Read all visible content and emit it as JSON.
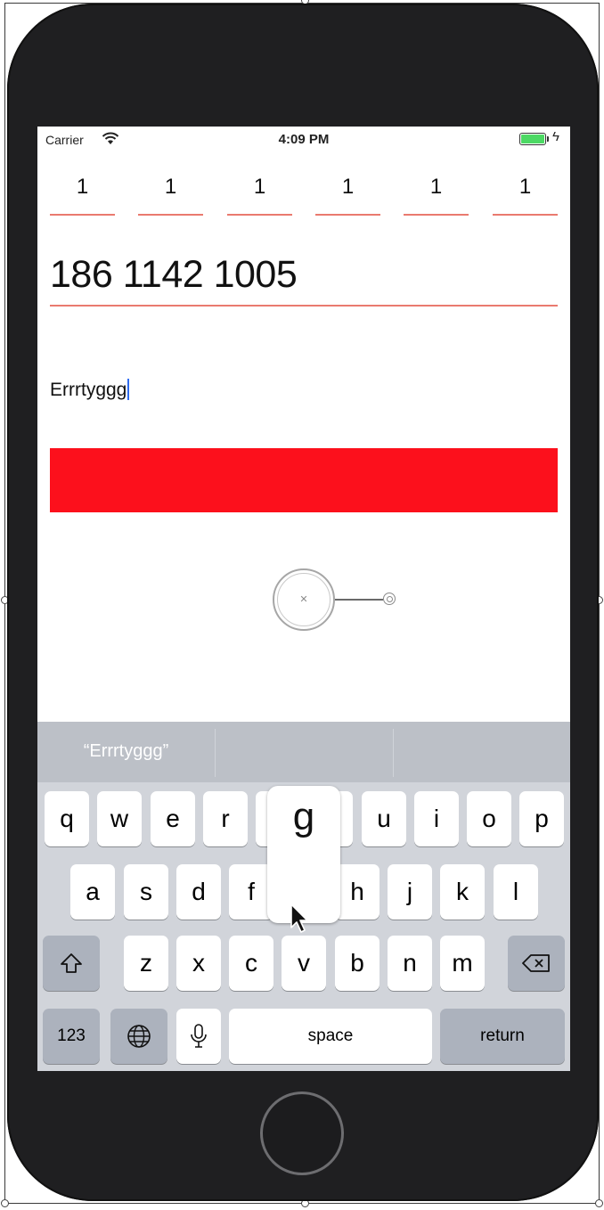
{
  "status_bar": {
    "carrier": "Carrier",
    "time": "4:09 PM",
    "battery_level": 1.0
  },
  "code_digits": [
    "1",
    "1",
    "1",
    "1",
    "1",
    "1"
  ],
  "phone_field": {
    "value": "186 1142 1005"
  },
  "text_field": {
    "value": "Errrtyggg"
  },
  "submit_button": {
    "label": "",
    "color": "#fc101c"
  },
  "keyboard": {
    "suggestions": [
      "“Errrtyggg”",
      "",
      ""
    ],
    "row1": [
      "q",
      "w",
      "e",
      "r",
      "t",
      "y",
      "u",
      "i",
      "o",
      "p"
    ],
    "row2": [
      "a",
      "s",
      "d",
      "f",
      "g",
      "h",
      "j",
      "k",
      "l"
    ],
    "row3": [
      "z",
      "x",
      "c",
      "v",
      "b",
      "n",
      "m"
    ],
    "numbers_key": "123",
    "space_key": "space",
    "return_key": "return",
    "pressed_key": "g",
    "shift_icon": "shift-icon",
    "delete_icon": "delete-icon",
    "globe_icon": "globe-icon",
    "mic_icon": "microphone-icon"
  },
  "colors": {
    "accent_underline": "#ea7a6f",
    "caret": "#2f6cf0"
  }
}
